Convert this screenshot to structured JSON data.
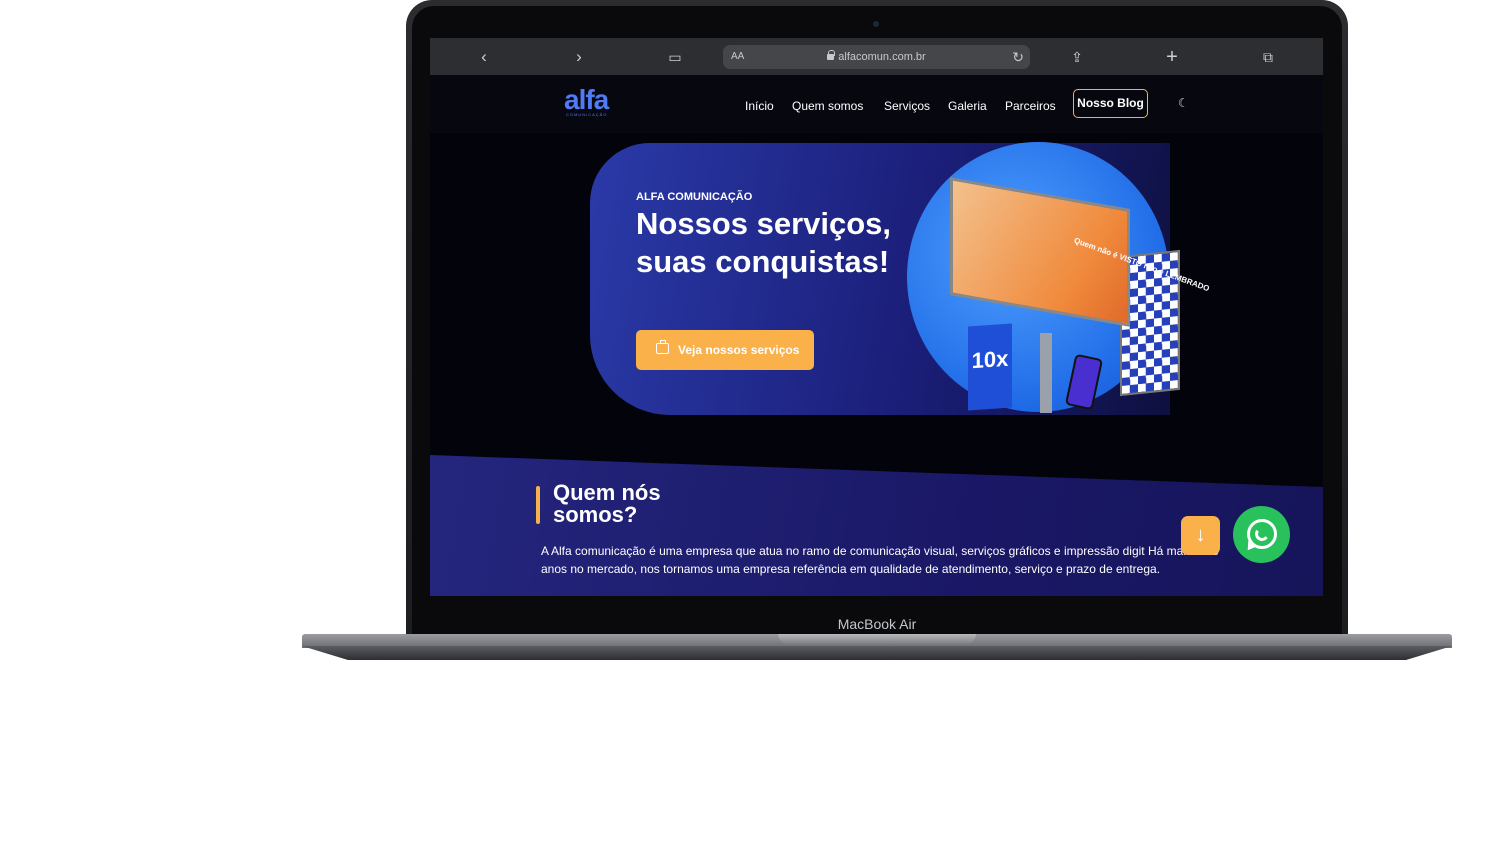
{
  "device": {
    "model_label": "MacBook Air"
  },
  "browser": {
    "text_size_label": "AA",
    "url": "alfacomun.com.br",
    "icons": [
      "back-icon",
      "forward-icon",
      "book-icon",
      "lock-icon",
      "reload-icon",
      "share-icon",
      "plus-icon",
      "tabs-icon"
    ]
  },
  "site": {
    "logo": "alfa",
    "logo_sub": "COMUNICAÇÃO",
    "nav": [
      "Início",
      "Quem somos",
      "Serviços",
      "Galeria",
      "Parceiros"
    ],
    "blog_button": "Nosso Blog",
    "theme_icon": "moon-icon"
  },
  "hero": {
    "kicker": "ALFA COMUNICAÇÃO",
    "headline": "Nossos serviços, suas conquistas!",
    "cta": "Veja nossos serviços",
    "billboard_text": "Quem não é VISTO não é LEMBRADO",
    "banner_text": "10x"
  },
  "about": {
    "title": "Quem nós somos?",
    "text": "A Alfa comunicação é uma empresa que atua no ramo de comunicação visual, serviços gráficos e impressão digit Há mais de 8 anos no mercado, nos tornamos uma empresa referência em qualidade de atendimento, serviço e prazo de entrega."
  },
  "colors": {
    "accent": "#fbb14a",
    "brand": "#4f7cf4",
    "whatsapp": "#29c15b"
  }
}
